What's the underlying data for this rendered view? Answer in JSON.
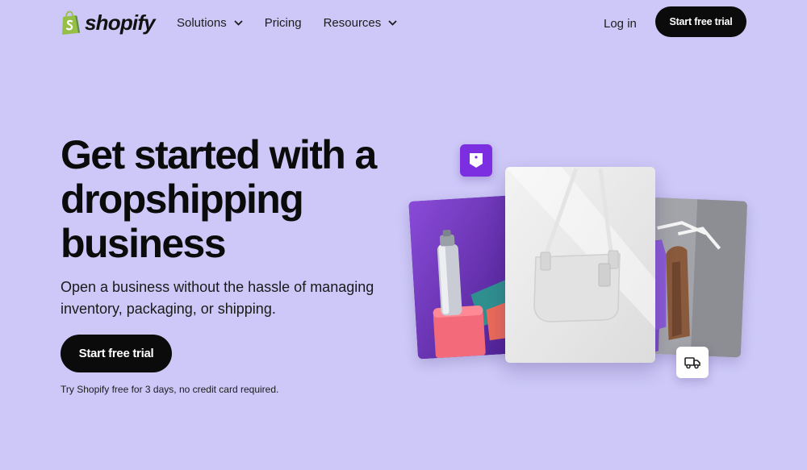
{
  "brand": {
    "name": "shopify",
    "logo_color": "#95bf47"
  },
  "nav": {
    "items": [
      {
        "label": "Solutions",
        "has_dropdown": true
      },
      {
        "label": "Pricing",
        "has_dropdown": false
      },
      {
        "label": "Resources",
        "has_dropdown": true
      }
    ],
    "login_label": "Log in",
    "cta_label": "Start free trial"
  },
  "hero": {
    "headline": "Get started with a dropshipping business",
    "subtitle": "Open a business without the hassle of managing inventory, packaging, or shipping.",
    "cta_label": "Start free trial",
    "disclaimer": "Try Shopify free for 3 days, no credit card required."
  },
  "collage": {
    "images": [
      {
        "name": "skincare-bottle-photo"
      },
      {
        "name": "white-handbag-photo"
      },
      {
        "name": "clothing-on-hangers-photo"
      }
    ],
    "badges": [
      {
        "icon": "tag-icon",
        "color": "#7b2fe0"
      },
      {
        "icon": "truck-icon",
        "color": "#ffffff"
      }
    ]
  },
  "colors": {
    "background": "#cdc8f7",
    "button": "#0b0b0b",
    "button_text": "#ffffff"
  }
}
